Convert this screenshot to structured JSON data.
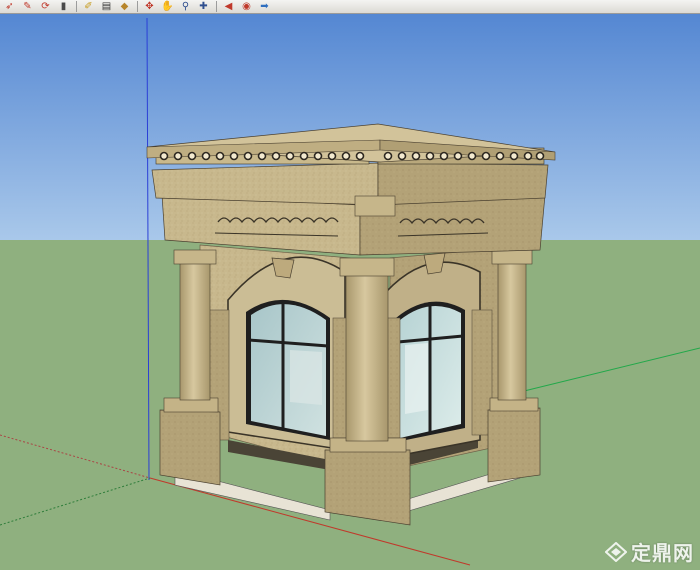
{
  "viewport": {
    "sky_color": "#5d8fd7",
    "ground_color": "#8fb07f"
  },
  "toolbar": {
    "buttons": [
      {
        "name": "select-icon",
        "glyph": "➶",
        "color": "#c0392b"
      },
      {
        "name": "eraser-icon",
        "glyph": "✎",
        "color": "#c0392b"
      },
      {
        "name": "paint-bucket-icon",
        "glyph": "⟳",
        "color": "#c0392b"
      },
      {
        "name": "make-component-icon",
        "glyph": "▮",
        "color": "#4a4a4a"
      },
      {
        "name": "tape-measure-icon",
        "glyph": "✐",
        "color": "#c69a1a"
      },
      {
        "name": "text-icon",
        "glyph": "▤",
        "color": "#333333"
      },
      {
        "name": "paint-icon",
        "glyph": "◆",
        "color": "#b7852a"
      },
      {
        "name": "orbit-icon",
        "glyph": "✥",
        "color": "#c0392b"
      },
      {
        "name": "pan-icon",
        "glyph": "✋",
        "color": "#c69a1a"
      },
      {
        "name": "zoom-icon",
        "glyph": "⚲",
        "color": "#2f4f8f"
      },
      {
        "name": "zoom-extents-icon",
        "glyph": "✚",
        "color": "#2f4f8f"
      },
      {
        "name": "previous-view-icon",
        "glyph": "◀",
        "color": "#c0392b"
      },
      {
        "name": "next-view-icon",
        "glyph": "◉",
        "color": "#c0392b"
      },
      {
        "name": "position-camera-icon",
        "glyph": "➡",
        "color": "#2f6fbf"
      }
    ]
  },
  "watermark": {
    "text": "定鼎网"
  }
}
